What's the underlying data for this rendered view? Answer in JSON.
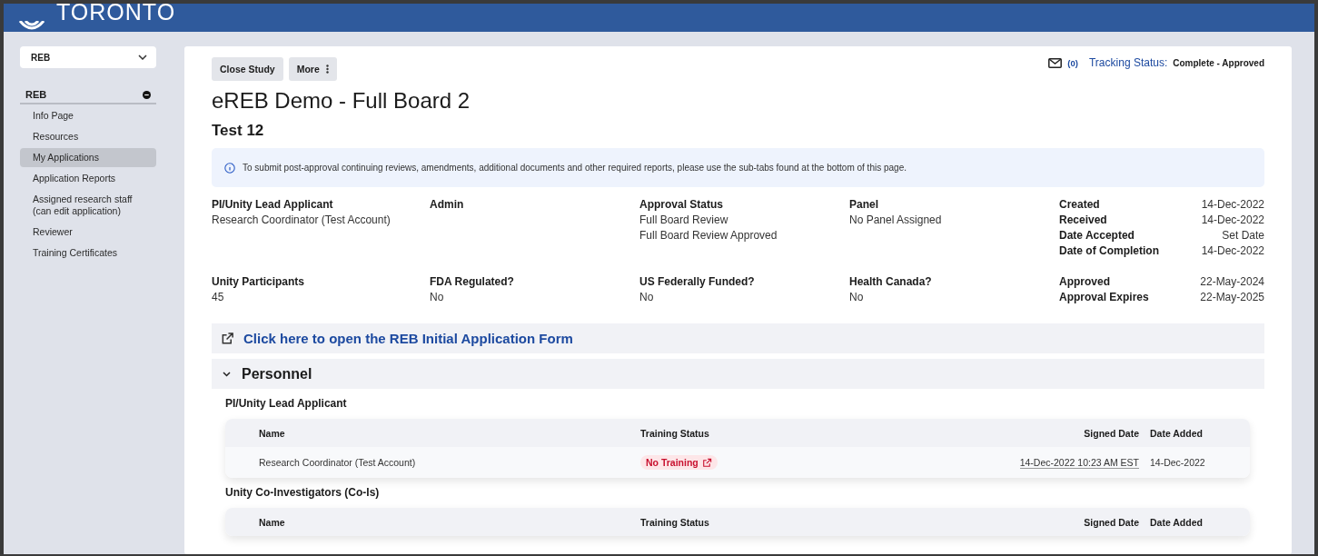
{
  "header": {
    "logo_text": "TORONTO"
  },
  "sidebar": {
    "dropdown": "REB",
    "section": {
      "title": "REB",
      "expanded": true
    },
    "items": [
      {
        "label": "Info Page",
        "selected": false
      },
      {
        "label": "Resources",
        "selected": false
      },
      {
        "label": "My Applications",
        "selected": true
      },
      {
        "label": "Application Reports",
        "selected": false
      },
      {
        "label": "Assigned research staff (can edit application)",
        "selected": false
      },
      {
        "label": "Reviewer",
        "selected": false
      },
      {
        "label": "Training Certificates",
        "selected": false
      }
    ]
  },
  "toolbar": {
    "buttons": [
      {
        "label": "Close Study",
        "kind": "plain"
      },
      {
        "label": "More",
        "kind": "menu"
      }
    ],
    "message_count": "(0)",
    "tracking_label": "Tracking Status:",
    "tracking_value": "Complete - Approved"
  },
  "title": "eREB Demo - Full Board 2",
  "subtitle": "Test 12",
  "notice": "To submit post-approval continuing reviews, amendments, additional documents and other required reports, please use the sub-tabs found at the bottom of this page.",
  "field_rows": [
    {
      "fields": [
        {
          "label": "PI/Unity Lead Applicant",
          "values": [
            "Research Coordinator (Test Account)"
          ]
        },
        {
          "label": "Admin"
        },
        {
          "label": "Approval Status",
          "values": [
            "Full Board Review",
            "Full Board Review Approved"
          ]
        },
        {
          "label": "Panel",
          "values": [
            "No Panel Assigned"
          ]
        }
      ],
      "dates": [
        {
          "label": "Created",
          "value": "14-Dec-2022"
        },
        {
          "label": "Received",
          "value": "14-Dec-2022"
        },
        {
          "label": "Date Accepted",
          "value": "Set Date"
        },
        {
          "label": "Date of Completion",
          "value": "14-Dec-2022"
        }
      ]
    },
    {
      "fields": [
        {
          "label": "Unity Participants",
          "values": [
            "45"
          ]
        },
        {
          "label": "FDA Regulated?",
          "values": [
            "No"
          ]
        },
        {
          "label": "US Federally Funded?",
          "values": [
            "No"
          ]
        },
        {
          "label": "Health Canada?",
          "values": [
            "No"
          ]
        }
      ],
      "dates": [
        {
          "label": "Approved",
          "value": "22-May-2024"
        },
        {
          "label": "Approval Expires",
          "value": "22-May-2025"
        }
      ]
    }
  ],
  "form_link": "Click here to open the REB Initial Application Form",
  "personnel": {
    "title": "Personnel",
    "expanded": true,
    "groups": [
      {
        "title": "PI/Unity Lead Applicant",
        "columns": [
          "Name",
          "Training Status",
          "Signed Date",
          "Date Added"
        ],
        "rows": [
          {
            "name": "Research Coordinator (Test Account)",
            "training": "No Training",
            "signed": "14-Dec-2022 10:23 AM EST",
            "added": "14-Dec-2022"
          }
        ]
      },
      {
        "title": "Unity Co-Investigators (Co-Is)",
        "columns": [
          "Name",
          "Training Status",
          "Signed Date",
          "Date Added"
        ]
      }
    ]
  }
}
